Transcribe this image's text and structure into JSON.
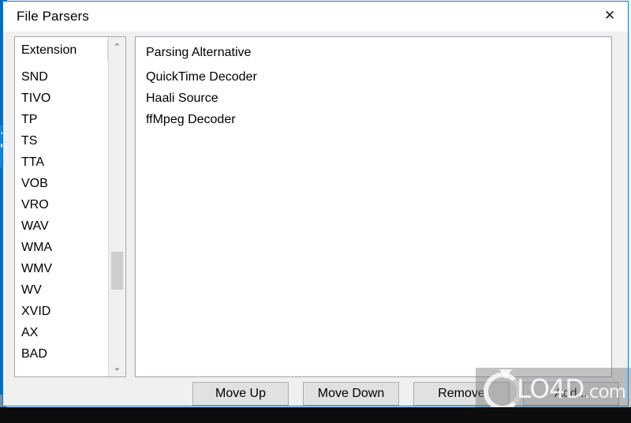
{
  "window": {
    "title": "File Parsers",
    "close_label": "✕",
    "accent_color": "#0078d7"
  },
  "extension_panel": {
    "column_header": "Extension",
    "items": [
      "SND",
      "TIVO",
      "TP",
      "TS",
      "TTA",
      "VOB",
      "VRO",
      "WAV",
      "WMA",
      "WMV",
      "WV",
      "XVID",
      "AX",
      "BAD"
    ],
    "scrollbar": {
      "up_arrow": "⌃",
      "down_arrow": "⌄"
    }
  },
  "parser_panel": {
    "column_header": "Parsing Alternative",
    "items": [
      "QuickTime Decoder",
      "Haali Source",
      "ffMpeg Decoder"
    ]
  },
  "buttons": {
    "move_up": "Move Up",
    "move_down": "Move Down",
    "remove": "Remove",
    "add": "Add..."
  },
  "watermark": {
    "brand": "LO4D",
    "suffix": ".com"
  }
}
